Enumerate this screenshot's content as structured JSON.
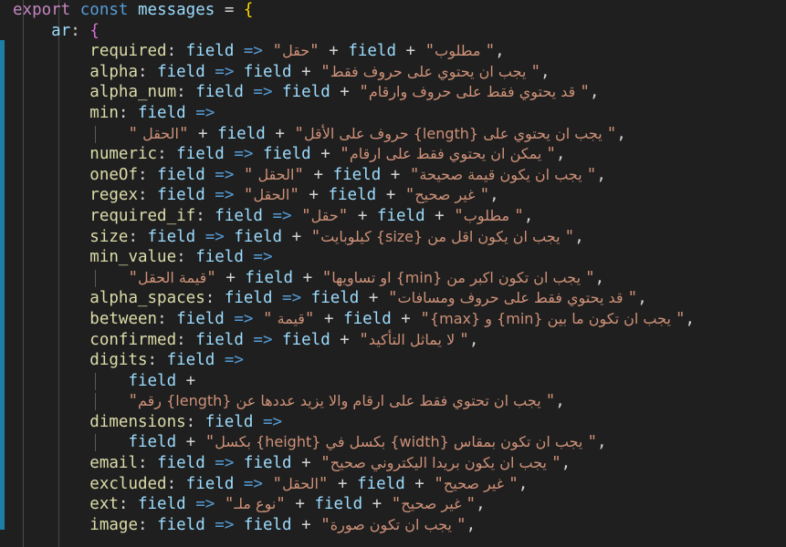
{
  "editor": {
    "theme": "dark-plus",
    "background": "#1f1f1f",
    "font_size_px": 17.5,
    "colors": {
      "keyword_magenta": "#c586c0",
      "keyword_blue": "#569cd6",
      "identifier": "#9cdcfe",
      "property": "#dcdcaa",
      "string": "#ce9178",
      "operator": "#d4d4d4",
      "bracket_yellow": "#ffd700",
      "bracket_magenta": "#da70d6",
      "bracket_blue": "#179fff",
      "change_bar": "#1d7fa5",
      "indent_guide": "#4a4a4a"
    }
  },
  "code": {
    "header": {
      "export": "export",
      "const": "const",
      "name": "messages",
      "equals": "=",
      "brace": "{"
    },
    "locale_key": "ar",
    "locale_colon": ":",
    "locale_brace": "{",
    "arrow": "=>",
    "field": "field",
    "plus": "+",
    "comma": ",",
    "quote": "\"",
    "entries": [
      {
        "key": "required",
        "parts": [
          "\"",
          "حقل",
          "\"",
          " + ",
          "field",
          " + ",
          "\"",
          " مطلوب",
          "\"",
          ","
        ]
      },
      {
        "key": "alpha",
        "parts": [
          "field",
          " + ",
          "\"",
          " يجب ان يحتوي على حروف فقط",
          "\"",
          ","
        ]
      },
      {
        "key": "alpha_num",
        "parts": [
          "field",
          " + ",
          "\"",
          " قد يحتوي فقط على حروف وارقام",
          "\"",
          ","
        ]
      },
      {
        "key": "min",
        "wrapped": true,
        "parts": [
          "\"",
          "الحقل ",
          "\"",
          " + ",
          "field",
          " + ",
          "\"",
          " يجب ان يحتوي على {length} حروف على الأقل",
          "\"",
          ","
        ]
      },
      {
        "key": "numeric",
        "parts": [
          "field",
          " + ",
          "\"",
          " يمكن ان يحتوي فقط على ارقام",
          "\"",
          ","
        ]
      },
      {
        "key": "oneOf",
        "parts": [
          "\"",
          "الحقل ",
          "\"",
          " + ",
          "field",
          " + ",
          "\"",
          " يجب ان يكون قيمة صحيحة",
          "\"",
          ","
        ]
      },
      {
        "key": "regex",
        "parts": [
          "\"",
          "الحقل",
          "\"",
          " + ",
          "field",
          " + ",
          "\"",
          " غير صحيح",
          "\"",
          ","
        ]
      },
      {
        "key": "required_if",
        "parts": [
          "\"",
          "حقل",
          "\"",
          " + ",
          "field",
          " + ",
          "\"",
          " مطلوب",
          "\"",
          ","
        ]
      },
      {
        "key": "size",
        "parts": [
          "field",
          " + ",
          "\"",
          " يجب ان يكون اقل من {size} كيلوبايت",
          "\"",
          ","
        ]
      },
      {
        "key": "min_value",
        "wrapped": true,
        "parts": [
          "\"",
          "قيمة الحقل",
          "\"",
          " + ",
          "field",
          " + ",
          "\"",
          " يجب ان تكون اكبر من {min} او تساويها",
          "\"",
          ","
        ]
      },
      {
        "key": "alpha_spaces",
        "parts": [
          "field",
          " + ",
          "\"",
          " قد يحتوي فقط على حروف ومسافات",
          "\"",
          ","
        ]
      },
      {
        "key": "between",
        "parts": [
          "\"",
          "قيمة ",
          "\"",
          " + ",
          "field",
          " + ",
          "\"",
          " يجب ان تكون ما بين {min} و {max}",
          "\"",
          ","
        ]
      },
      {
        "key": "confirmed",
        "parts": [
          "field",
          " + ",
          "\"",
          " لا يماثل التأكيد",
          "\"",
          ","
        ]
      },
      {
        "key": "digits",
        "wrapped2": true,
        "parts": [
          "field",
          " + ",
          "\"",
          " يجب ان تحتوي فقط على ارقام والا يزيد عددها عن {length} رقم",
          "\"",
          ","
        ]
      },
      {
        "key": "dimensions",
        "wrapped": true,
        "parts": [
          "field",
          " + ",
          "\"",
          " يجب ان تكون بمقاس {width} بكسل في {height} بكسل",
          "\"",
          ","
        ]
      },
      {
        "key": "email",
        "parts": [
          "field",
          " + ",
          "\"",
          " يجب ان يكون بريدا اليكتروني صحيح",
          "\"",
          ","
        ]
      },
      {
        "key": "excluded",
        "parts": [
          "\"",
          "الحقل",
          "\"",
          " + ",
          "field",
          " + ",
          "\"",
          " غير صحيح",
          "\"",
          ","
        ]
      },
      {
        "key": "ext",
        "parts": [
          "\"",
          "نوع ملـ",
          "\"",
          " + ",
          "field",
          " + ",
          "\"",
          " غير صحيح",
          "\"",
          ","
        ]
      },
      {
        "key": "image",
        "parts": [
          "field",
          " + ",
          "\"",
          " يجب ان تكون صورة",
          "\"",
          ","
        ]
      }
    ],
    "lines": [
      {
        "id": "l1",
        "indent": 0
      },
      {
        "id": "l2",
        "indent": 1
      },
      {
        "id": "l3",
        "indent": 2
      },
      {
        "id": "l4",
        "indent": 2
      },
      {
        "id": "l5",
        "indent": 2
      },
      {
        "id": "l6",
        "indent": 2
      },
      {
        "id": "l7",
        "indent": 3
      },
      {
        "id": "l8",
        "indent": 2
      },
      {
        "id": "l9",
        "indent": 2
      },
      {
        "id": "l10",
        "indent": 2
      },
      {
        "id": "l11",
        "indent": 2
      },
      {
        "id": "l12",
        "indent": 2
      },
      {
        "id": "l13",
        "indent": 2
      },
      {
        "id": "l14",
        "indent": 3
      },
      {
        "id": "l15",
        "indent": 2
      },
      {
        "id": "l16",
        "indent": 2
      },
      {
        "id": "l17",
        "indent": 2
      },
      {
        "id": "l18",
        "indent": 2
      },
      {
        "id": "l19",
        "indent": 3
      },
      {
        "id": "l20",
        "indent": 3
      },
      {
        "id": "l21",
        "indent": 2
      },
      {
        "id": "l22",
        "indent": 3
      },
      {
        "id": "l23",
        "indent": 2
      },
      {
        "id": "l24",
        "indent": 2
      },
      {
        "id": "l25",
        "indent": 2
      },
      {
        "id": "l26",
        "indent": 2
      }
    ]
  },
  "text": {
    "export": "export",
    "const": "const",
    "messages": "messages",
    "eq": " = ",
    "brace_open": "{",
    "ar": "ar",
    "colon_space": ": ",
    "field": "field",
    "arrow": " => ",
    "plus_sp": " + ",
    "q": "\"",
    "comma": ",",
    "sp": " ",
    "k_required": "required",
    "k_alpha": "alpha",
    "k_alpha_num": "alpha_num",
    "k_min": "min",
    "k_numeric": "numeric",
    "k_oneOf": "oneOf",
    "k_regex": "regex",
    "k_required_if": "required_if",
    "k_size": "size",
    "k_min_value": "min_value",
    "k_alpha_spaces": "alpha_spaces",
    "k_between": "between",
    "k_confirmed": "confirmed",
    "k_digits": "digits",
    "k_dimensions": "dimensions",
    "k_email": "email",
    "k_excluded": "excluded",
    "k_ext": "ext",
    "k_image": "image",
    "a_haql": "حقل",
    "a_matlub": " مطلوب",
    "a_alpha": " يجب ان يحتوي على حروف فقط",
    "a_alphanum": " قد يحتوي فقط على حروف وارقام",
    "a_alhaql_sp": "الحقل ",
    "a_min": " يجب ان يحتوي على {length} حروف على الأقل",
    "a_numeric": " يمكن ان يحتوي فقط على ارقام",
    "a_oneof": " يجب ان يكون قيمة صحيحة",
    "a_alhaql": "الحقل",
    "a_ghayr": " غير صحيح",
    "a_size": " يجب ان يكون اقل من {size} كيلوبايت",
    "a_qimat_alhaql": "قيمة الحقل",
    "a_minvalue": " يجب ان تكون اكبر من {min} او تساويها",
    "a_alphaspaces": " قد يحتوي فقط على حروف ومسافات",
    "a_qima_sp": "قيمة ",
    "a_between": " يجب ان تكون ما بين {min} و {max}",
    "a_confirmed": " لا يماثل التأكيد",
    "a_digits": " يجب ان تحتوي فقط على ارقام والا يزيد عددها عن {length} رقم",
    "a_dimensions": " يجب ان تكون بمقاس {width} بكسل في {height} بكسل",
    "a_email": " يجب ان يكون بريدا اليكتروني صحيح",
    "a_nawe_mil": "نوع ملـ",
    "a_image": " يجب ان تكون صورة",
    "indent1": "    ",
    "indent2": "        ",
    "indent3": "            "
  }
}
